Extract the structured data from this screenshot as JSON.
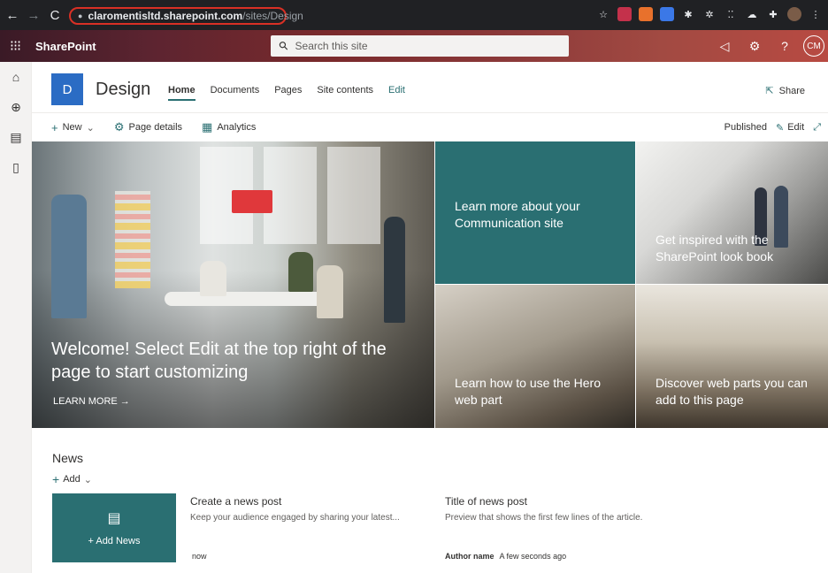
{
  "browser": {
    "back": "←",
    "forward": "→",
    "reload": "C",
    "url_host": "claromentisltd.sharepoint.com",
    "url_path": "/sites/Design"
  },
  "suite": {
    "brand": "SharePoint",
    "search_placeholder": "Search this site",
    "help": "?",
    "user_initials": "CM"
  },
  "site": {
    "logo_letter": "D",
    "title": "Design",
    "nav": [
      "Home",
      "Documents",
      "Pages",
      "Site contents",
      "Edit"
    ],
    "share": "Share"
  },
  "commands": {
    "new": "New",
    "page_details": "Page details",
    "analytics": "Analytics",
    "published": "Published",
    "edit": "Edit"
  },
  "hero": {
    "main_title": "Welcome! Select Edit at the top right of the page to start customizing",
    "learn_more": "LEARN MORE →",
    "tile_teal": "Learn more about your Communication site",
    "tile_b": "Get inspired with the SharePoint look book",
    "tile_c": "Learn how to use the Hero web part",
    "tile_d": "Discover web parts you can add to this page"
  },
  "news": {
    "title": "News",
    "add": "Add",
    "add_news": "+ Add News",
    "post1_title": "Create a news post",
    "post1_desc": "Keep your audience engaged by sharing your latest...",
    "post1_meta": "now",
    "post2_title": "Title of news post",
    "post2_desc": "Preview that shows the first few lines of the article.",
    "post2_author": "Author name",
    "post2_time": "A few seconds ago"
  },
  "colors": {
    "accent": "#2a6f72",
    "logo": "#2b6cc4"
  }
}
